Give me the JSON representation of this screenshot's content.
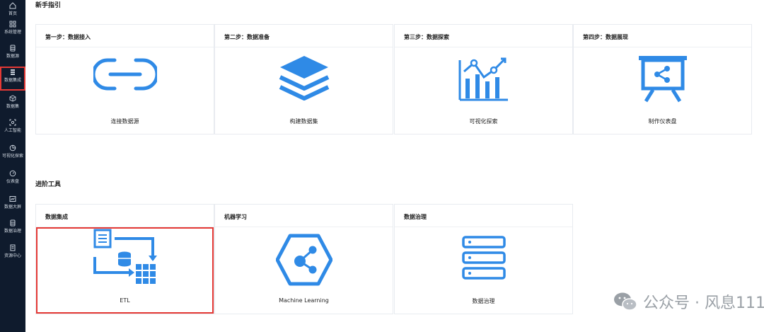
{
  "sidebar": {
    "items": [
      {
        "label": "首页",
        "icon": "home-icon"
      },
      {
        "label": "系统管理",
        "icon": "grid-icon"
      },
      {
        "label": "数据源",
        "icon": "database-icon"
      },
      {
        "label": "数据集成",
        "icon": "integration-icon",
        "active": true
      },
      {
        "label": "数据集",
        "icon": "cube-icon"
      },
      {
        "label": "人工智能",
        "icon": "ai-icon"
      },
      {
        "label": "可视化探索",
        "icon": "pie-icon"
      },
      {
        "label": "仪表盘",
        "icon": "gauge-icon"
      },
      {
        "label": "数据大屏",
        "icon": "screen-icon"
      },
      {
        "label": "数据治理",
        "icon": "governance-icon"
      },
      {
        "label": "资源中心",
        "icon": "resource-icon"
      }
    ]
  },
  "guide": {
    "title": "新手指引",
    "cards": [
      {
        "head": "第一步：数据接入",
        "label": "连接数据源",
        "icon": "link-icon"
      },
      {
        "head": "第二步：数据准备",
        "label": "构建数据集",
        "icon": "layers-icon"
      },
      {
        "head": "第三步：数据探索",
        "label": "可视化探索",
        "icon": "chart-icon"
      },
      {
        "head": "第四步：数据展现",
        "label": "制作仪表盘",
        "icon": "presentation-icon"
      }
    ]
  },
  "advanced": {
    "title": "进阶工具",
    "cards": [
      {
        "head": "数据集成",
        "label": "ETL",
        "icon": "etl-icon",
        "highlighted": true
      },
      {
        "head": "机器学习",
        "label": "Machine Learning",
        "icon": "machine-learning-icon"
      },
      {
        "head": "数据治理",
        "label": "数据治理",
        "icon": "server-icon"
      }
    ]
  },
  "watermark": {
    "text": "公众号 · 风息111",
    "icon": "wechat-icon"
  },
  "colors": {
    "accent": "#2f8ae6",
    "sidebar_bg": "#0f1b2d",
    "highlight": "#e53935"
  }
}
